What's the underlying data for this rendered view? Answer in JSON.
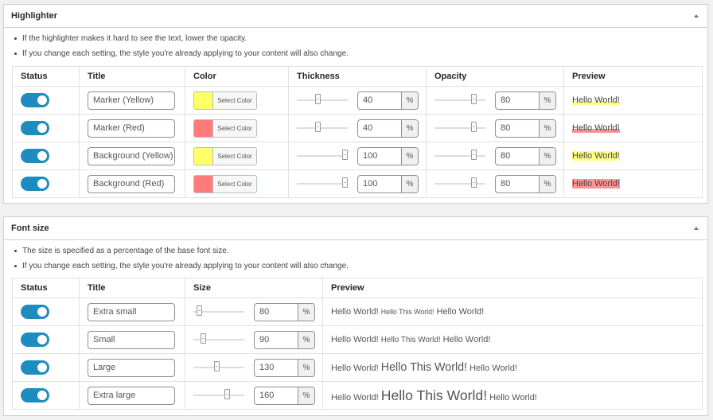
{
  "highlighter": {
    "title": "Highlighter",
    "notes": [
      "If the highlighter makes it hard to see the text, lower the opacity.",
      "If you change each setting, the style you're already applying to your content will also change."
    ],
    "columns": [
      "Status",
      "Title",
      "Color",
      "Thickness",
      "Opacity",
      "Preview"
    ],
    "select_color_label": "Select Color",
    "unit": "%",
    "preview_text": "Hello World!",
    "rows": [
      {
        "enabled": true,
        "title": "Marker (Yellow)",
        "color": "#ffff66",
        "thickness": 40,
        "opacity": 80,
        "style": "marker"
      },
      {
        "enabled": true,
        "title": "Marker (Red)",
        "color": "#ff7a7a",
        "thickness": 40,
        "opacity": 80,
        "style": "marker"
      },
      {
        "enabled": true,
        "title": "Background (Yellow)",
        "color": "#ffff66",
        "thickness": 100,
        "opacity": 80,
        "style": "background"
      },
      {
        "enabled": true,
        "title": "Background (Red)",
        "color": "#ff7a7a",
        "thickness": 100,
        "opacity": 80,
        "style": "background"
      }
    ]
  },
  "font_size": {
    "title": "Font size",
    "notes": [
      "The size is specified as a percentage of the base font size.",
      "If you change each setting, the style you're already applying to your content will also change."
    ],
    "columns": [
      "Status",
      "Title",
      "Size",
      "Preview"
    ],
    "unit": "%",
    "preview_outer": "Hello World!",
    "preview_inner": "Hello This World!",
    "rows": [
      {
        "enabled": true,
        "title": "Extra small",
        "size": 80
      },
      {
        "enabled": true,
        "title": "Small",
        "size": 90
      },
      {
        "enabled": true,
        "title": "Large",
        "size": 130
      },
      {
        "enabled": true,
        "title": "Extra large",
        "size": 160
      }
    ]
  },
  "colors": {
    "accent": "#1e8cbe",
    "yellow": "#ffff66",
    "red": "#ff7a7a"
  },
  "icons": {
    "collapse": "triangle-up-icon"
  }
}
